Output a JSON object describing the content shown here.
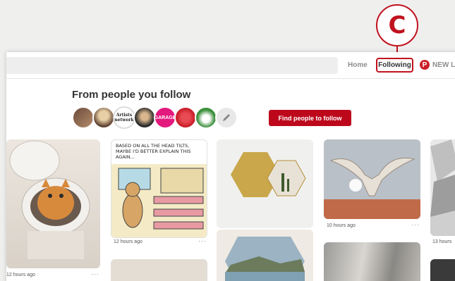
{
  "callout": {
    "letter": "C"
  },
  "nav": {
    "home": "Home",
    "following": "Following",
    "new": "NEW L"
  },
  "section": {
    "title": "From people you follow"
  },
  "avatars": [
    {
      "name": "avatar-1",
      "label": ""
    },
    {
      "name": "avatar-2",
      "label": ""
    },
    {
      "name": "avatar-artists-network",
      "label": "Artists network"
    },
    {
      "name": "avatar-4",
      "label": ""
    },
    {
      "name": "avatar-garage",
      "label": "GARAGE"
    },
    {
      "name": "avatar-6",
      "label": ""
    },
    {
      "name": "avatar-7",
      "label": ""
    },
    {
      "name": "avatar-edit",
      "label": ""
    }
  ],
  "find_button": "Find people to follow",
  "pins": {
    "cat": {
      "time": "12 hours ago",
      "more": "···"
    },
    "comic": {
      "caption": "BASED ON ALL THE HEAD TILTS, MAYBE I'D BETTER EXPLAIN THIS AGAIN...",
      "time": "12 hours ago",
      "more": "···"
    },
    "gold": {},
    "skull": {
      "time": "10 hours ago",
      "more": "···"
    },
    "geometric": {
      "time": "13 hours"
    }
  },
  "colors": {
    "accent_red": "#c1121f",
    "button_red": "#bd081c",
    "pinterest_red": "#cb2027"
  }
}
